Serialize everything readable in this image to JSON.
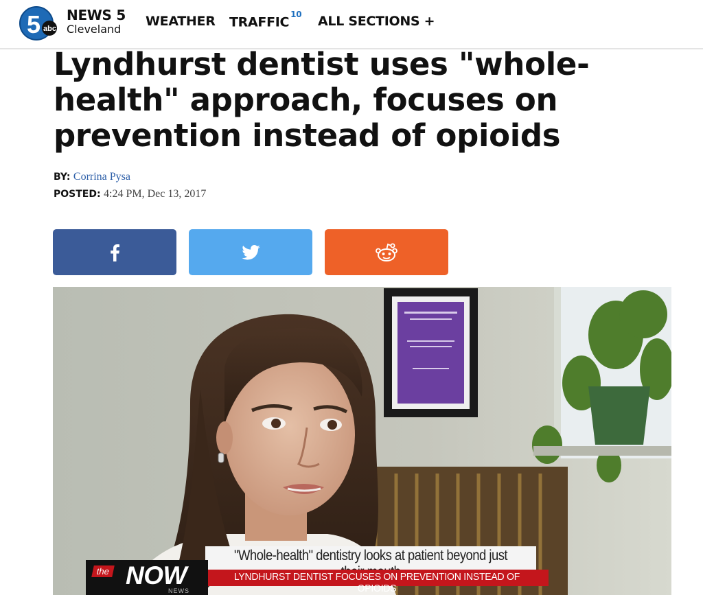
{
  "header": {
    "logo": {
      "number": "5",
      "network": "abc"
    },
    "brand_name": "NEWS 5",
    "brand_city": "Cleveland",
    "nav": {
      "weather": "WEATHER",
      "traffic": "TRAFFIC",
      "traffic_count": "10",
      "all_sections": "ALL SECTIONS +"
    }
  },
  "article": {
    "headline": "Lyndhurst dentist uses \"whole-health\" approach, focuses on prevention instead of opioids",
    "by_label": "BY:",
    "author": "Corrina Pysa",
    "posted_label": "POSTED:",
    "posted_date": "4:24 PM, Dec 13, 2017"
  },
  "share": {
    "facebook": {
      "icon": "facebook-icon",
      "color": "#3b5b98"
    },
    "twitter": {
      "icon": "twitter-icon",
      "color": "#55a9ee"
    },
    "reddit": {
      "icon": "reddit-icon",
      "color": "#ee6128"
    }
  },
  "video": {
    "lower_third_line1": "\"Whole-health\" dentistry looks at patient beyond just their mouth",
    "lower_third_line2": "LYNDHURST DENTIST FOCUSES ON PREVENTION INSTEAD OF OPIOIDS",
    "badge_the": "the",
    "badge_now": "NOW",
    "badge_station": "NEWS"
  },
  "colors": {
    "link_blue": "#2d5fa8",
    "badge_blue": "#1d6fbf",
    "news_red": "#c4161c"
  }
}
